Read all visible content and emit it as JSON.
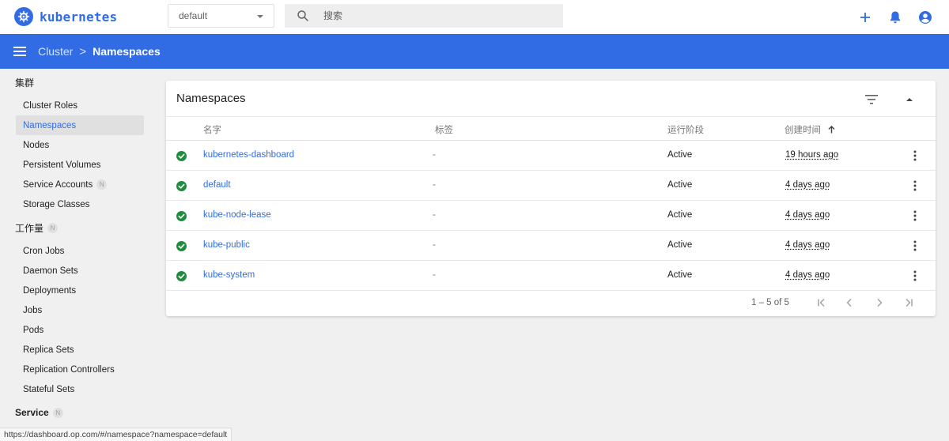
{
  "app": {
    "name": "kubernetes",
    "brand_color": "#326ce5"
  },
  "topbar": {
    "namespace_select": {
      "value": "default"
    },
    "search": {
      "placeholder": "搜索"
    },
    "actions": [
      "add-icon",
      "bell-icon",
      "account-icon"
    ]
  },
  "breadcrumb": {
    "parent": "Cluster",
    "separator": ">",
    "current": "Namespaces"
  },
  "sidebar": {
    "cluster_group": {
      "label": "集群"
    },
    "cluster_items": [
      {
        "label": "Cluster Roles"
      },
      {
        "label": "Namespaces"
      },
      {
        "label": "Nodes"
      },
      {
        "label": "Persistent Volumes"
      },
      {
        "label": "Service Accounts",
        "badge": "N"
      },
      {
        "label": "Storage Classes"
      }
    ],
    "workloads_group": {
      "label": "工作量",
      "badge": "N"
    },
    "workload_items": [
      {
        "label": "Cron Jobs"
      },
      {
        "label": "Daemon Sets"
      },
      {
        "label": "Deployments"
      },
      {
        "label": "Jobs"
      },
      {
        "label": "Pods"
      },
      {
        "label": "Replica Sets"
      },
      {
        "label": "Replication Controllers"
      },
      {
        "label": "Stateful Sets"
      }
    ],
    "service_group": {
      "label": "Service",
      "badge": "N"
    }
  },
  "card": {
    "title": "Namespaces",
    "columns": {
      "name": "名字",
      "labels": "标签",
      "phase": "运行阶段",
      "created": "创建时间"
    },
    "rows": [
      {
        "name": "kubernetes-dashboard",
        "labels": "-",
        "phase": "Active",
        "created": "19 hours ago"
      },
      {
        "name": "default",
        "labels": "-",
        "phase": "Active",
        "created": "4 days ago"
      },
      {
        "name": "kube-node-lease",
        "labels": "-",
        "phase": "Active",
        "created": "4 days ago"
      },
      {
        "name": "kube-public",
        "labels": "-",
        "phase": "Active",
        "created": "4 days ago"
      },
      {
        "name": "kube-system",
        "labels": "-",
        "phase": "Active",
        "created": "4 days ago"
      }
    ],
    "pagination": {
      "range": "1 – 5 of 5"
    }
  },
  "statusbar": {
    "url": "https://dashboard.op.com/#/namespace?namespace=default"
  },
  "colors": {
    "header_bg": "#326ce5",
    "ok_green": "#1e8e3e",
    "page_bg": "#f0f0f0"
  }
}
